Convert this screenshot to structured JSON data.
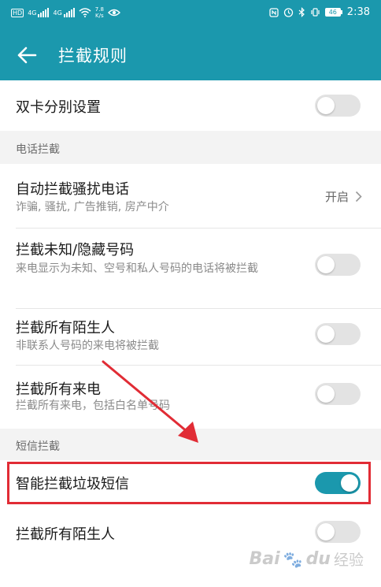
{
  "status_bar": {
    "net_tag_1": "HD",
    "net_tag_2": "4G",
    "net_tag_3": "4G",
    "speed": "7.8",
    "speed_unit": "K/s",
    "battery": "46",
    "time": "2:38"
  },
  "appbar": {
    "title": "拦截规则"
  },
  "rows": {
    "dual_sim": {
      "title": "双卡分别设置",
      "on": false
    },
    "auto_block": {
      "title": "自动拦截骚扰电话",
      "subtitle": "诈骗, 骚扰, 广告推销, 房产中介",
      "value": "开启"
    },
    "unknown_numbers": {
      "title": "拦截未知/隐藏号码",
      "subtitle": "来电显示为未知、空号和私人号码的电话将被拦截",
      "on": false
    },
    "all_strangers_call": {
      "title": "拦截所有陌生人",
      "subtitle": "非联系人号码的来电将被拦截",
      "on": false
    },
    "all_calls": {
      "title": "拦截所有来电",
      "subtitle": "拦截所有来电，包括白名单号码",
      "on": false
    },
    "smart_sms": {
      "title": "智能拦截垃圾短信",
      "on": true
    },
    "all_strangers_sms": {
      "title": "拦截所有陌生人",
      "on": false
    }
  },
  "sections": {
    "phone": "电话拦截",
    "sms": "短信拦截"
  },
  "watermark": {
    "brand": "Bai",
    "brand_end": "du",
    "suffix": "经验"
  },
  "colors": {
    "accent": "#1b98ad",
    "annotation": "#e12c35"
  }
}
